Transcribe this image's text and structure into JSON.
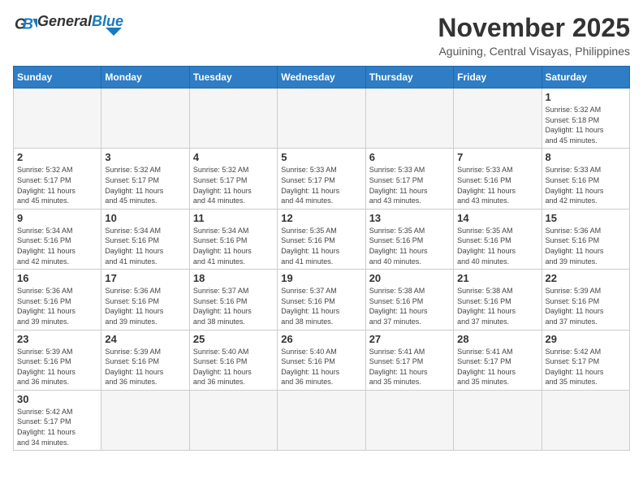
{
  "header": {
    "logo_general": "General",
    "logo_blue": "Blue",
    "month_year": "November 2025",
    "location": "Aguining, Central Visayas, Philippines"
  },
  "days_of_week": [
    "Sunday",
    "Monday",
    "Tuesday",
    "Wednesday",
    "Thursday",
    "Friday",
    "Saturday"
  ],
  "weeks": [
    [
      {
        "day": "",
        "info": ""
      },
      {
        "day": "",
        "info": ""
      },
      {
        "day": "",
        "info": ""
      },
      {
        "day": "",
        "info": ""
      },
      {
        "day": "",
        "info": ""
      },
      {
        "day": "",
        "info": ""
      },
      {
        "day": "1",
        "info": "Sunrise: 5:32 AM\nSunset: 5:18 PM\nDaylight: 11 hours\nand 45 minutes."
      }
    ],
    [
      {
        "day": "2",
        "info": "Sunrise: 5:32 AM\nSunset: 5:17 PM\nDaylight: 11 hours\nand 45 minutes."
      },
      {
        "day": "3",
        "info": "Sunrise: 5:32 AM\nSunset: 5:17 PM\nDaylight: 11 hours\nand 45 minutes."
      },
      {
        "day": "4",
        "info": "Sunrise: 5:32 AM\nSunset: 5:17 PM\nDaylight: 11 hours\nand 44 minutes."
      },
      {
        "day": "5",
        "info": "Sunrise: 5:33 AM\nSunset: 5:17 PM\nDaylight: 11 hours\nand 44 minutes."
      },
      {
        "day": "6",
        "info": "Sunrise: 5:33 AM\nSunset: 5:17 PM\nDaylight: 11 hours\nand 43 minutes."
      },
      {
        "day": "7",
        "info": "Sunrise: 5:33 AM\nSunset: 5:16 PM\nDaylight: 11 hours\nand 43 minutes."
      },
      {
        "day": "8",
        "info": "Sunrise: 5:33 AM\nSunset: 5:16 PM\nDaylight: 11 hours\nand 42 minutes."
      }
    ],
    [
      {
        "day": "9",
        "info": "Sunrise: 5:34 AM\nSunset: 5:16 PM\nDaylight: 11 hours\nand 42 minutes."
      },
      {
        "day": "10",
        "info": "Sunrise: 5:34 AM\nSunset: 5:16 PM\nDaylight: 11 hours\nand 41 minutes."
      },
      {
        "day": "11",
        "info": "Sunrise: 5:34 AM\nSunset: 5:16 PM\nDaylight: 11 hours\nand 41 minutes."
      },
      {
        "day": "12",
        "info": "Sunrise: 5:35 AM\nSunset: 5:16 PM\nDaylight: 11 hours\nand 41 minutes."
      },
      {
        "day": "13",
        "info": "Sunrise: 5:35 AM\nSunset: 5:16 PM\nDaylight: 11 hours\nand 40 minutes."
      },
      {
        "day": "14",
        "info": "Sunrise: 5:35 AM\nSunset: 5:16 PM\nDaylight: 11 hours\nand 40 minutes."
      },
      {
        "day": "15",
        "info": "Sunrise: 5:36 AM\nSunset: 5:16 PM\nDaylight: 11 hours\nand 39 minutes."
      }
    ],
    [
      {
        "day": "16",
        "info": "Sunrise: 5:36 AM\nSunset: 5:16 PM\nDaylight: 11 hours\nand 39 minutes."
      },
      {
        "day": "17",
        "info": "Sunrise: 5:36 AM\nSunset: 5:16 PM\nDaylight: 11 hours\nand 39 minutes."
      },
      {
        "day": "18",
        "info": "Sunrise: 5:37 AM\nSunset: 5:16 PM\nDaylight: 11 hours\nand 38 minutes."
      },
      {
        "day": "19",
        "info": "Sunrise: 5:37 AM\nSunset: 5:16 PM\nDaylight: 11 hours\nand 38 minutes."
      },
      {
        "day": "20",
        "info": "Sunrise: 5:38 AM\nSunset: 5:16 PM\nDaylight: 11 hours\nand 37 minutes."
      },
      {
        "day": "21",
        "info": "Sunrise: 5:38 AM\nSunset: 5:16 PM\nDaylight: 11 hours\nand 37 minutes."
      },
      {
        "day": "22",
        "info": "Sunrise: 5:39 AM\nSunset: 5:16 PM\nDaylight: 11 hours\nand 37 minutes."
      }
    ],
    [
      {
        "day": "23",
        "info": "Sunrise: 5:39 AM\nSunset: 5:16 PM\nDaylight: 11 hours\nand 36 minutes."
      },
      {
        "day": "24",
        "info": "Sunrise: 5:39 AM\nSunset: 5:16 PM\nDaylight: 11 hours\nand 36 minutes."
      },
      {
        "day": "25",
        "info": "Sunrise: 5:40 AM\nSunset: 5:16 PM\nDaylight: 11 hours\nand 36 minutes."
      },
      {
        "day": "26",
        "info": "Sunrise: 5:40 AM\nSunset: 5:16 PM\nDaylight: 11 hours\nand 36 minutes."
      },
      {
        "day": "27",
        "info": "Sunrise: 5:41 AM\nSunset: 5:17 PM\nDaylight: 11 hours\nand 35 minutes."
      },
      {
        "day": "28",
        "info": "Sunrise: 5:41 AM\nSunset: 5:17 PM\nDaylight: 11 hours\nand 35 minutes."
      },
      {
        "day": "29",
        "info": "Sunrise: 5:42 AM\nSunset: 5:17 PM\nDaylight: 11 hours\nand 35 minutes."
      }
    ],
    [
      {
        "day": "30",
        "info": "Sunrise: 5:42 AM\nSunset: 5:17 PM\nDaylight: 11 hours\nand 34 minutes."
      },
      {
        "day": "",
        "info": ""
      },
      {
        "day": "",
        "info": ""
      },
      {
        "day": "",
        "info": ""
      },
      {
        "day": "",
        "info": ""
      },
      {
        "day": "",
        "info": ""
      },
      {
        "day": "",
        "info": ""
      }
    ]
  ]
}
